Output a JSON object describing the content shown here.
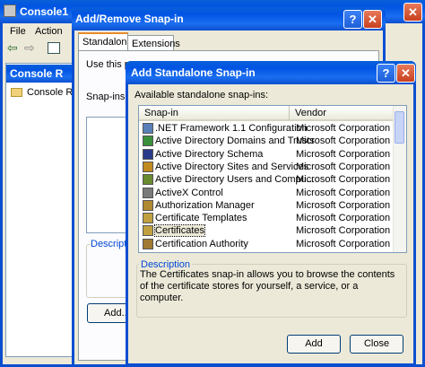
{
  "console": {
    "title": "Console1",
    "menu": [
      "File",
      "Action"
    ],
    "tree_title": "Console R",
    "tree_root": "Console Ro"
  },
  "addremove": {
    "title": "Add/Remove Snap-in",
    "tabs": [
      "Standalone",
      "Extensions"
    ],
    "use_this": "Use this pa",
    "snapins_label": "Snap-ins a",
    "description_label": "Descriptio",
    "add_button": "Add..."
  },
  "dialog": {
    "title": "Add Standalone Snap-in",
    "available_label": "Available standalone snap-ins:",
    "columns": [
      "Snap-in",
      "Vendor"
    ],
    "rows": [
      {
        "name": ".NET Framework 1.1 Configuration",
        "vendor": "Microsoft Corporation",
        "icon": "net-config-icon",
        "color": "#5a7fb8"
      },
      {
        "name": "Active Directory Domains and Trusts",
        "vendor": "Microsoft Corporation",
        "icon": "ad-domains-icon",
        "color": "#3a8f3a"
      },
      {
        "name": "Active Directory Schema",
        "vendor": "Microsoft Corporation",
        "icon": "ad-schema-icon",
        "color": "#2a3a8a"
      },
      {
        "name": "Active Directory Sites and Services",
        "vendor": "Microsoft Corporation",
        "icon": "ad-sites-icon",
        "color": "#c08a20"
      },
      {
        "name": "Active Directory Users and Compu...",
        "vendor": "Microsoft Corporation",
        "icon": "ad-users-icon",
        "color": "#6a8a30"
      },
      {
        "name": "ActiveX Control",
        "vendor": "Microsoft Corporation",
        "icon": "activex-icon",
        "color": "#7a7a7a"
      },
      {
        "name": "Authorization Manager",
        "vendor": "Microsoft Corporation",
        "icon": "auth-manager-icon",
        "color": "#b08a30"
      },
      {
        "name": "Certificate Templates",
        "vendor": "Microsoft Corporation",
        "icon": "cert-templates-icon",
        "color": "#c0a040"
      },
      {
        "name": "Certificates",
        "vendor": "Microsoft Corporation",
        "icon": "certificates-icon",
        "color": "#c0a040"
      },
      {
        "name": "Certification Authority",
        "vendor": "Microsoft Corporation",
        "icon": "cert-authority-icon",
        "color": "#a07a30"
      }
    ],
    "selected_index": 8,
    "description_title": "Description",
    "description_text": "The Certificates snap-in allows you to browse the contents of the certificate stores for yourself, a service, or a computer.",
    "add_button": "Add",
    "close_button": "Close"
  }
}
